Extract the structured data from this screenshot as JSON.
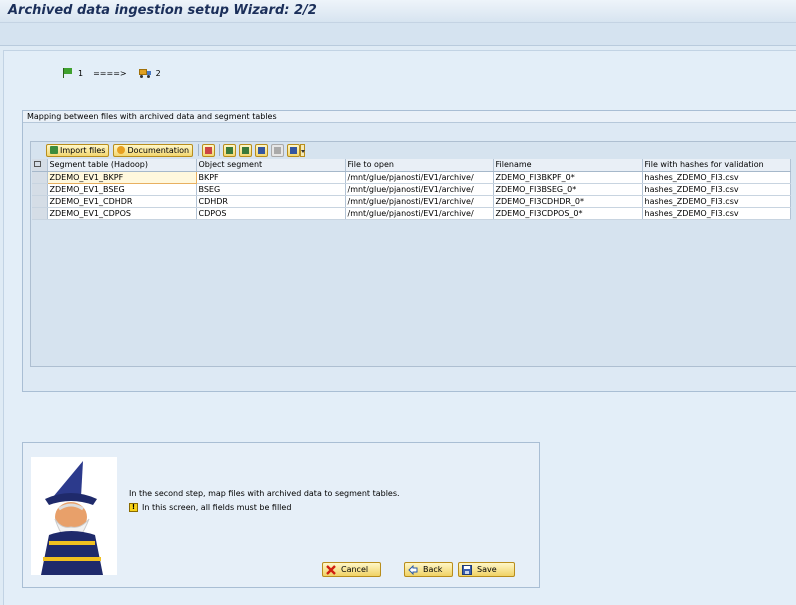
{
  "window": {
    "title": "Archived data ingestion setup Wizard: 2/2"
  },
  "steps": {
    "step1": "1",
    "arrow": "====>",
    "step2": "2"
  },
  "group": {
    "title": "Mapping between files with archived data and segment tables"
  },
  "grid_toolbar": {
    "import_label": "Import files",
    "doc_label": "Documentation"
  },
  "table": {
    "columns": [
      "Segment table (Hadoop)",
      "Object segment",
      "File to open",
      "Filename",
      "File with hashes for validation"
    ],
    "rows": [
      [
        "ZDEMO_EV1_BKPF",
        "BKPF",
        "/mnt/glue/pjanosti/EV1/archive/",
        "ZDEMO_FI3BKPF_0*",
        "hashes_ZDEMO_FI3.csv"
      ],
      [
        "ZDEMO_EV1_BSEG",
        "BSEG",
        "/mnt/glue/pjanosti/EV1/archive/",
        "ZDEMO_FI3BSEG_0*",
        "hashes_ZDEMO_FI3.csv"
      ],
      [
        "ZDEMO_EV1_CDHDR",
        "CDHDR",
        "/mnt/glue/pjanosti/EV1/archive/",
        "ZDEMO_FI3CDHDR_0*",
        "hashes_ZDEMO_FI3.csv"
      ],
      [
        "ZDEMO_EV1_CDPOS",
        "CDPOS",
        "/mnt/glue/pjanosti/EV1/archive/",
        "ZDEMO_FI3CDPOS_0*",
        "hashes_ZDEMO_FI3.csv"
      ]
    ]
  },
  "wizard": {
    "message": "In the second step, map files with archived data to segment tables.",
    "warning": "In this screen, all fields must be filled"
  },
  "buttons": {
    "cancel": "Cancel",
    "back": "Back",
    "save": "Save"
  },
  "icons": {
    "step1": "flag-icon",
    "step2": "truck-icon",
    "warning": "warning-icon"
  },
  "colors": {
    "title": "#1b2f5a",
    "button": "#f2d670",
    "background": "#dfebf5"
  }
}
